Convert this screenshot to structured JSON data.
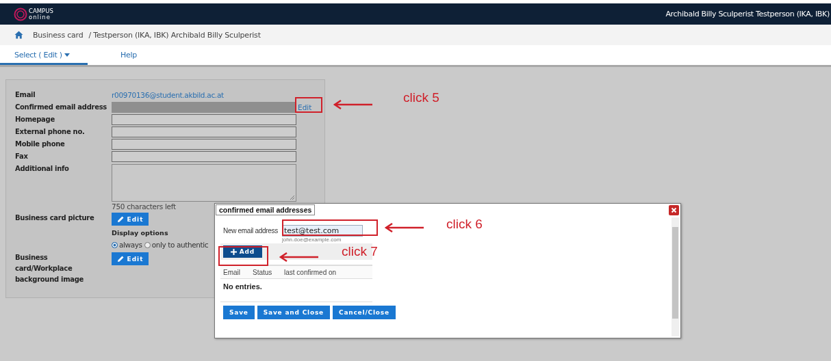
{
  "header": {
    "logo_top": "CAMPUS",
    "logo_bottom": "online",
    "user": "Archibald Billy Sculperist Testperson (IKA, IBK)"
  },
  "breadcrumb": {
    "current": "Business card",
    "path": "/ Testperson (IKA, IBK) Archibald Billy Sculperist"
  },
  "tabs": [
    {
      "label": "Select ( Edit )",
      "selected": true,
      "dropdown": true
    },
    {
      "label": "Help",
      "selected": false,
      "dropdown": false
    }
  ],
  "form": {
    "rows": [
      {
        "kind": "link",
        "label": "Email",
        "value": "r00970136@student.akbild.ac.at"
      },
      {
        "kind": "field",
        "label": "Confirmed email address",
        "disabled": true,
        "action": "Edit"
      },
      {
        "kind": "field",
        "label": "Homepage",
        "disabled": false
      },
      {
        "kind": "field",
        "label": "External phone no.",
        "disabled": false
      },
      {
        "kind": "field",
        "label": "Mobile phone",
        "disabled": false
      },
      {
        "kind": "field",
        "label": "Fax",
        "disabled": false
      },
      {
        "kind": "textarea",
        "label": "Additional info",
        "counter": "750 characters left"
      },
      {
        "kind": "button",
        "label": "Business card picture",
        "button": "Edit",
        "options_title": "Display options",
        "radios": [
          {
            "label": "always",
            "selected": true
          },
          {
            "label": "only to authentic",
            "selected": false
          }
        ]
      },
      {
        "kind": "button",
        "label": "Business card/Workplace background image",
        "button": "Edit"
      }
    ]
  },
  "dialog": {
    "title": "confirmed email addresses",
    "input_label": "New email address",
    "input_value": "test@test.com",
    "hint": "john.doe@example.com",
    "add_button": "Add",
    "columns": [
      "Email",
      "Status",
      "last confirmed on"
    ],
    "empty": "No entries.",
    "buttons": [
      "Save",
      "Save and Close",
      "Cancel/Close"
    ]
  },
  "annotations": [
    {
      "label": "click 5"
    },
    {
      "label": "click 6"
    },
    {
      "label": "click 7"
    }
  ]
}
